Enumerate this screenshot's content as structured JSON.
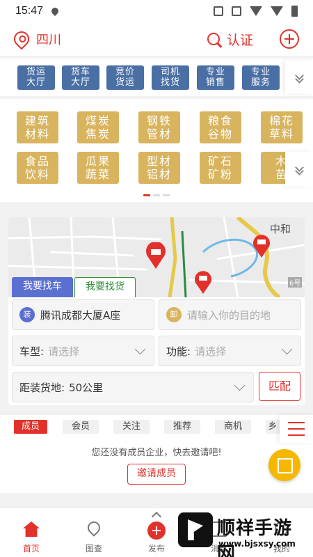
{
  "status_bar": {
    "time": "15:47"
  },
  "header": {
    "city": "四川",
    "auth_label": "认证"
  },
  "service_tabs": [
    {
      "line1": "货运",
      "line2": "大厅"
    },
    {
      "line1": "货车",
      "line2": "大厅"
    },
    {
      "line1": "竞价",
      "line2": "货运"
    },
    {
      "line1": "司机",
      "line2": "找货"
    },
    {
      "line1": "专业",
      "line2": "销售"
    },
    {
      "line1": "专业",
      "line2": "服务"
    }
  ],
  "categories": [
    {
      "line1": "建筑",
      "line2": "材料"
    },
    {
      "line1": "煤炭",
      "line2": "焦炭"
    },
    {
      "line1": "钢铁",
      "line2": "管材"
    },
    {
      "line1": "粮食",
      "line2": "谷物"
    },
    {
      "line1": "棉花",
      "line2": "草料"
    },
    {
      "line1": "食品",
      "line2": "饮料"
    },
    {
      "line1": "瓜果",
      "line2": "蔬菜"
    },
    {
      "line1": "型材",
      "line2": "铝材"
    },
    {
      "line1": "矿石",
      "line2": "矿粉"
    },
    {
      "line1": "木",
      "line2": "苗"
    }
  ],
  "map": {
    "place_label": "中和",
    "road_label": "6号"
  },
  "finder": {
    "tab_truck": "我要找车",
    "tab_goods": "我要找货",
    "load_badge": "装",
    "load_value": "腾讯成都大厦A座",
    "unload_badge": "卸",
    "unload_placeholder": "请输入你的目的地",
    "truck_type_label": "车型:",
    "truck_type_placeholder": "请选择",
    "function_label": "功能:",
    "function_placeholder": "请选择",
    "distance_label": "距装货地:",
    "distance_value": "50公里",
    "match_label": "匹配"
  },
  "member_tabs": [
    "成员",
    "会员",
    "关注",
    "推荐",
    "商机",
    "乡"
  ],
  "members": {
    "empty_text": "您还没有成员企业，快去邀请吧!",
    "invite_label": "邀请成员"
  },
  "tab_bar": [
    "首页",
    "图查",
    "发布",
    "消息",
    "我的"
  ],
  "watermark": {
    "title": "顺祥手游网",
    "url": "www.bjsxsy.com"
  },
  "colors": {
    "accent": "#e2312a",
    "tab_blue": "#4a6fa5",
    "category_gold": "#d9b45e",
    "finder_blue": "#5b6fd1",
    "finder_green": "#2e8b3a",
    "fab_yellow": "#f5b800"
  }
}
